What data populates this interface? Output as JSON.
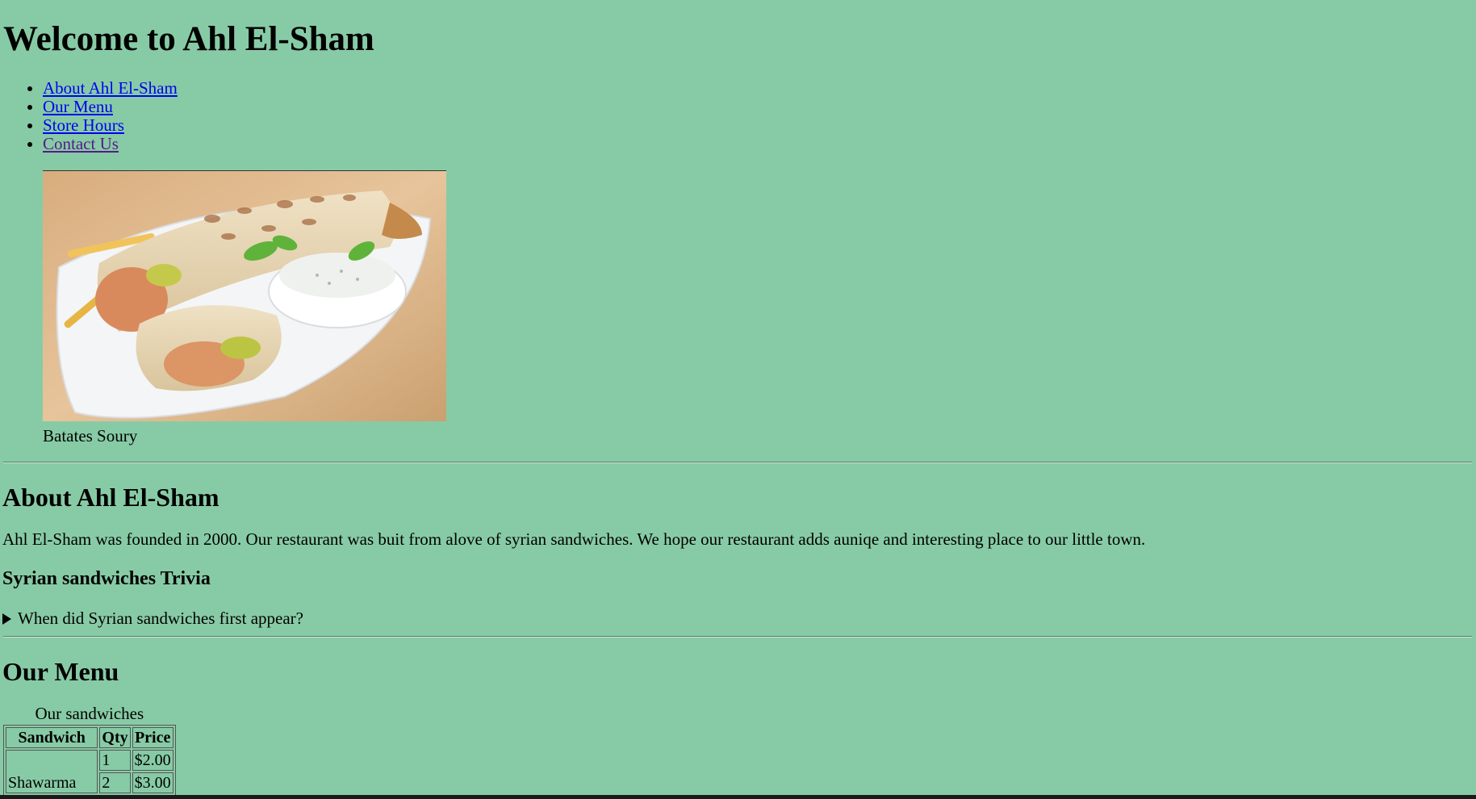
{
  "header": {
    "title": "Welcome to Ahl El-Sham"
  },
  "nav": {
    "items": [
      {
        "label": "About Ahl El-Sham"
      },
      {
        "label": "Our Menu"
      },
      {
        "label": "Store Hours"
      },
      {
        "label": "Contact Us"
      }
    ]
  },
  "figure": {
    "caption": "Batates Soury"
  },
  "about": {
    "heading": "About Ahl El-Sham",
    "text": "Ahl El-Sham was founded in 2000. Our restaurant was buit from alove of syrian sandwiches. We hope our restaurant adds auniqe and interesting place to our little town.",
    "trivia_heading": "Syrian sandwiches Trivia",
    "trivia_question": "When did Syrian sandwiches first appear?"
  },
  "menu": {
    "heading": "Our Menu",
    "table_caption": "Our sandwiches",
    "columns": [
      "Sandwich",
      "Qty",
      "Price"
    ],
    "rows": [
      {
        "sandwich": "Shawarma",
        "qty": "1",
        "price": "$2.00"
      },
      {
        "sandwich": "",
        "qty": "2",
        "price": "$3.00"
      }
    ]
  },
  "colors": {
    "background": "#87cba6",
    "link": "#0000ee",
    "visited_link": "#551a8b"
  }
}
